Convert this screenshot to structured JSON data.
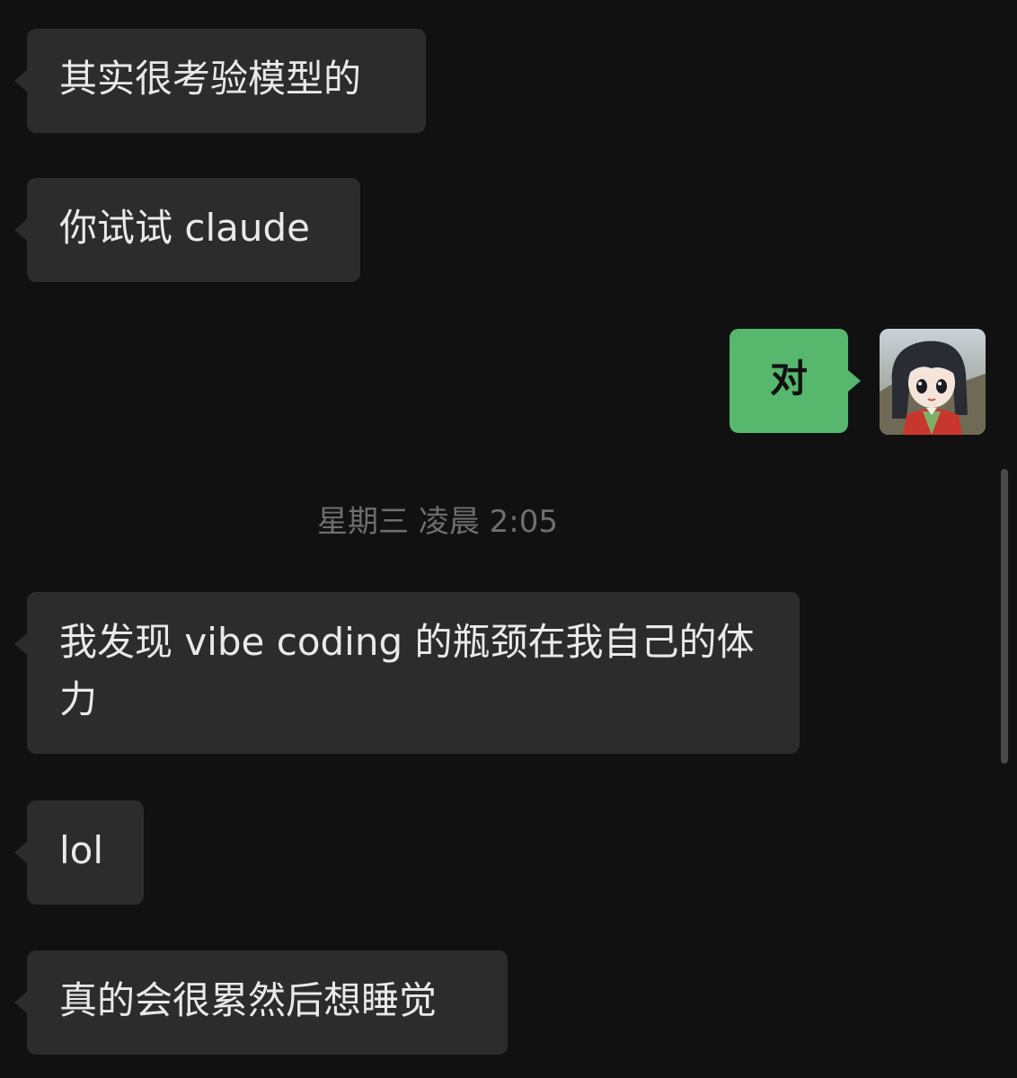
{
  "messages": [
    {
      "id": "m1",
      "direction": "incoming",
      "text": "其实很考验模型的"
    },
    {
      "id": "m2",
      "direction": "incoming",
      "text": "你试试 claude"
    },
    {
      "id": "m3",
      "direction": "outgoing",
      "text": "对"
    },
    {
      "id": "m4",
      "direction": "incoming",
      "text": "我发现 vibe coding 的瓶颈在我自己的体力"
    },
    {
      "id": "m5",
      "direction": "incoming",
      "text": "lol"
    },
    {
      "id": "m6",
      "direction": "incoming",
      "text": "真的会很累然后想睡觉"
    }
  ],
  "timestamp": "星期三 凌晨 2:05",
  "colors": {
    "background": "#111111",
    "incoming_bubble": "#2c2c2c",
    "outgoing_bubble": "#56b76d",
    "timestamp_text": "#6e6e6e"
  },
  "icons": {
    "avatar": "user-avatar-anime-girl"
  }
}
